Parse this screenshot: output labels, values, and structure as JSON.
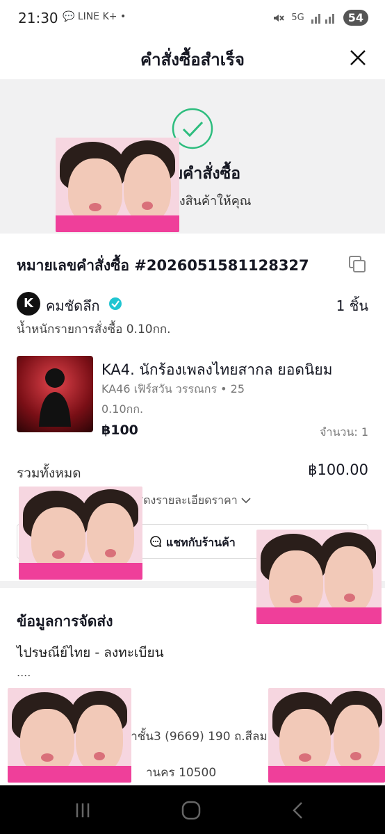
{
  "status_bar": {
    "time": "21:30",
    "notifications": "💬 LINE K+ •",
    "network": "5G",
    "battery": "54"
  },
  "header": {
    "title": "คำสั่งซื้อสำเร็จ"
  },
  "success": {
    "title": "าหรับคำสั่งซื้อ",
    "subtitle": "รียมจัดส่งสินค้าให้คุณ"
  },
  "order": {
    "order_number": "หมายเลขคำสั่งซื้อ #2026051581128327",
    "shop": {
      "avatar_text": "K",
      "name": "คมชัดลึก",
      "item_count": "1 ชิ้น"
    },
    "weight": "น้ำหนักรายการสั่งซื้อ 0.10กก.",
    "product": {
      "name": "KA4. นักร้องเพลงไทยสากล ยอดนิยม",
      "variant": "KA46 เฟิร์สวัน วรรณกร • 25",
      "weight": "0.10กก.",
      "price": "฿100",
      "quantity": "จำนวน: 1"
    },
    "total_label": "รวมทั้งหมด",
    "total_value": "฿100.00",
    "price_detail": "แสดงรายละเอียดราคา",
    "chat_label": "แชทกับร้านค้า"
  },
  "shipping": {
    "title": "ข้อมูลการจัดส่ง",
    "method": "ไปรษณีย์ไทย - ลงทะเบียน",
    "dots": "....",
    "address_line1": "งยาชั้น3 (9669) 190 ถ.สีลม",
    "address_line2": "านคร 10500"
  },
  "colors": {
    "accent_green": "#2dbd7e",
    "verified_teal": "#20c5d1",
    "panel_gray": "#f1f1f2"
  }
}
